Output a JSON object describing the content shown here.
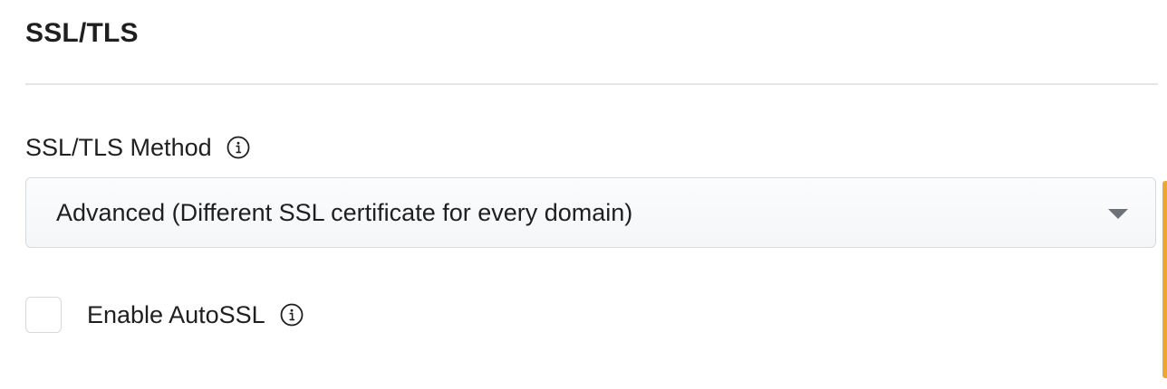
{
  "section": {
    "title": "SSL/TLS"
  },
  "ssl_method": {
    "label": "SSL/TLS Method",
    "info_icon": "info-circle",
    "selected_value": "Advanced (Different SSL certificate for every domain)"
  },
  "autossl": {
    "label": "Enable AutoSSL",
    "checked": false,
    "info_icon": "info-circle"
  },
  "colors": {
    "accent": "#f0a637",
    "text": "#1f1f1f",
    "border": "#d7dbe0"
  }
}
